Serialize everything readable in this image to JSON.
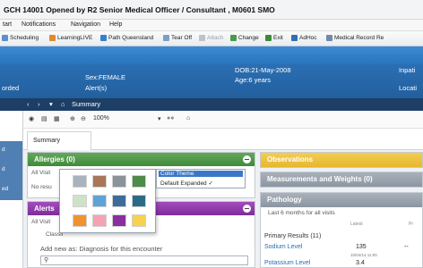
{
  "window": {
    "title": "GCH 14001      Opened by R2 Senior Medical Officer / Consultant , M0601 SMO"
  },
  "menubar": {
    "items": [
      "tart",
      "Notifications",
      "Navigation",
      "Help"
    ]
  },
  "toolbar": {
    "items": [
      "Scheduling",
      "LearningLIVE",
      "Path Queensland",
      "Tear Off",
      "Attach",
      "Change",
      "Exit",
      "AdHoc",
      "Medical Record Re"
    ]
  },
  "banner": {
    "left_label": "orded",
    "sex": "Sex:FEMALE",
    "alerts": "Alert(s)",
    "dob": "DOB:21-May-2008",
    "age": "Age:6 years",
    "inpatient": "Inpati",
    "location": "Locati"
  },
  "nav": {
    "page": "Summary"
  },
  "content_toolbar": {
    "zoom": "100%"
  },
  "tabs": {
    "summary": "Summary"
  },
  "left_strip": {
    "labels": [
      "d",
      "d",
      "ed"
    ]
  },
  "allergies": {
    "title": "Allergies (0)",
    "all_visits": "All Visit",
    "no_results": "No resu"
  },
  "alerts": {
    "title": "Alerts",
    "all_visits": "All Visit",
    "classification": "Classif",
    "add_new": "Add new as: Diagnosis for this encounter"
  },
  "color_menu": {
    "items": [
      "Color Theme",
      "Default Expanded ✓"
    ],
    "swatches": [
      "#a9b3bd",
      "#a9765a",
      "#8a929a",
      "#4e8a48",
      "#cfe2c9",
      "#5fa3d6",
      "#3d6c9a",
      "#2c6b88",
      "#f0932f",
      "#f5a3b3",
      "#8a2f9f",
      "#f7d24e"
    ]
  },
  "observations": {
    "title": "Observations"
  },
  "measurements": {
    "title": "Measurements and Weights (0)"
  },
  "pathology": {
    "title": "Pathology",
    "subtitle": "Last 6 months for all visits",
    "col_latest": "Latest",
    "col_previous": "Pr",
    "section": "Primary Results (11)",
    "rows": [
      {
        "name": "Sodium Level",
        "value": "135",
        "date": "10/04/14 11:00",
        "prev": "--"
      },
      {
        "name": "Potassium Level",
        "value": "3.4",
        "date": "",
        "prev": ""
      }
    ]
  },
  "colors": {
    "green": "#3f8a3a",
    "purple": "#7d2d99",
    "yellow": "#e7b72e",
    "banner": "#225f9e"
  }
}
